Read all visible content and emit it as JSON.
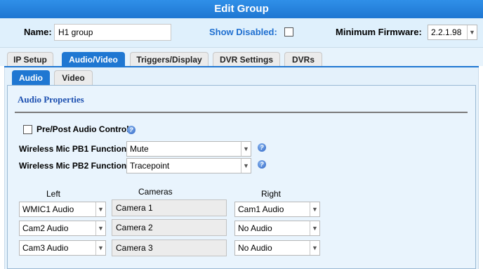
{
  "window": {
    "title": "Edit Group"
  },
  "header": {
    "name_label": "Name:",
    "name_value": "H1 group",
    "show_disabled_label": "Show Disabled:",
    "show_disabled_checked": false,
    "min_firmware_label": "Minimum Firmware:",
    "min_firmware_value": "2.2.1.98"
  },
  "tabs": [
    "IP Setup",
    "Audio/Video",
    "Triggers/Display",
    "DVR Settings",
    "DVRs"
  ],
  "active_tab": "Audio/Video",
  "subtabs": [
    "Audio",
    "Video"
  ],
  "active_subtab": "Audio",
  "audio": {
    "section_title": "Audio Properties",
    "pre_post_label": "Pre/Post Audio Control",
    "pre_post_checked": false,
    "pb1_label": "Wireless Mic PB1 Function",
    "pb1_value": "Mute",
    "pb2_label": "Wireless Mic PB2 Function",
    "pb2_value": "Tracepoint",
    "col_left": "Left",
    "col_cameras": "Cameras",
    "col_right": "Right",
    "rows": [
      {
        "left": "WMIC1 Audio",
        "camera": "Camera 1",
        "right": "Cam1 Audio"
      },
      {
        "left": "Cam2 Audio",
        "camera": "Camera 2",
        "right": "No Audio"
      },
      {
        "left": "Cam3 Audio",
        "camera": "Camera 3",
        "right": "No Audio"
      }
    ]
  },
  "icons": {
    "help": "help-icon",
    "dropdown": "chevron-down-icon",
    "checkbox": "checkbox-icon"
  },
  "colors": {
    "title_bar": "#1f77d2",
    "active_tab": "#1f77d2",
    "header_bg": "#dff0fc",
    "panel_bg": "#e9f4fd",
    "section_title": "#1c4fb0",
    "field_label_blue": "#1f6fd0"
  }
}
